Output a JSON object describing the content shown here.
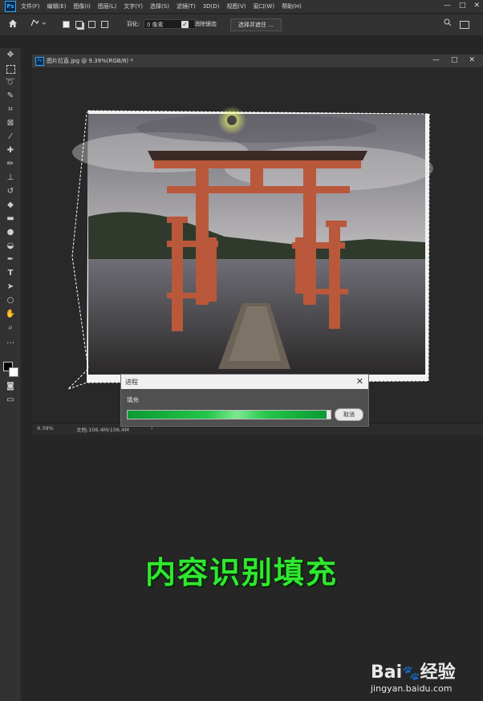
{
  "menubar": {
    "logo": "Ps",
    "items": [
      "文件(F)",
      "编辑(E)",
      "图像(I)",
      "图层(L)",
      "文字(Y)",
      "选择(S)",
      "滤镜(T)",
      "3D(D)",
      "视图(V)",
      "窗口(W)",
      "帮助(H)"
    ],
    "window_controls": [
      "—",
      "□",
      "✕"
    ]
  },
  "options": {
    "feather_label": "羽化:",
    "feather_value": "0 像素",
    "antialias_label": "消除锯齿",
    "subject_button": "选择并遮住 ..."
  },
  "document": {
    "tab_title": "图片拉直.jpg @ 9.39%(RGB/8) *",
    "controls": [
      "—",
      "□",
      "✕"
    ],
    "zoom": "9.39%",
    "doc_info": "文档:106.4M/106.4M"
  },
  "dialog": {
    "title": "进程",
    "label": "填充",
    "cancel": "取消",
    "progress_fraction": 0.98
  },
  "caption": "内容识别填充",
  "watermark": {
    "brand": "Bai",
    "brand2": "经验",
    "url": "jingyan.baidu.com"
  },
  "colors": {
    "progress": "#23c649",
    "caption": "#30e830",
    "accent": "#31a8ff"
  }
}
